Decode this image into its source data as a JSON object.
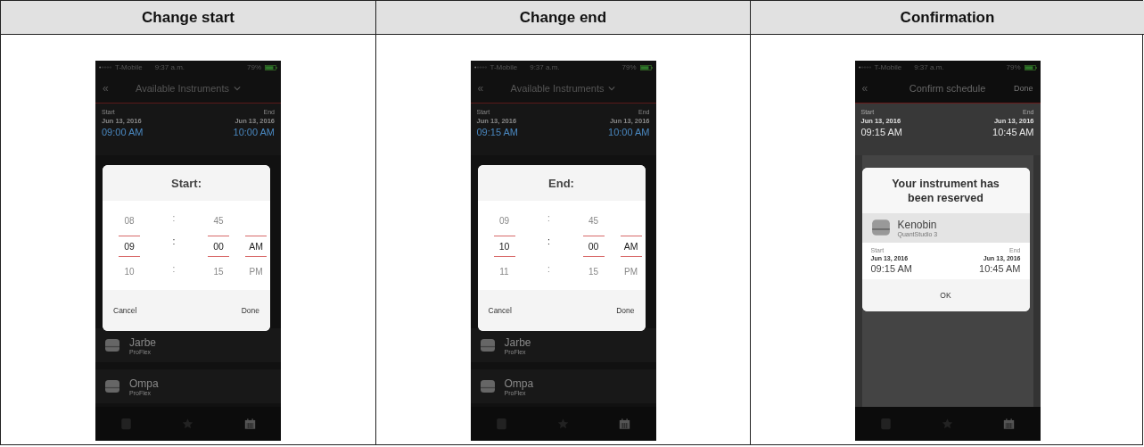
{
  "columns": [
    {
      "heading": "Change start"
    },
    {
      "heading": "Change end"
    },
    {
      "heading": "Confirmation"
    }
  ],
  "screens": [
    {
      "kind": "picker",
      "status": {
        "carrier": "T-Mobile",
        "time": "9:37 a.m.",
        "battery": "79%"
      },
      "nav": {
        "back": "«",
        "title": "Available Instruments",
        "dropdown": true
      },
      "schedule": {
        "start": {
          "label": "Start",
          "date": "Jun 13, 2016",
          "time": "09:00 AM"
        },
        "end": {
          "label": "End",
          "date": "Jun 13, 2016",
          "time": "10:00 AM"
        }
      },
      "instruments": [
        {
          "name": "Jarbe",
          "model": "ProFlex"
        },
        {
          "name": "Ompa",
          "model": "ProFlex"
        }
      ],
      "dialog": {
        "title": "Start:",
        "rows": [
          {
            "hour": "08",
            "separator": ":",
            "minute": "45",
            "selected": false
          },
          {
            "hour": "09",
            "separator": ":",
            "minute": "00",
            "period": "AM",
            "selected": true
          },
          {
            "hour": "10",
            "separator": ":",
            "minute": "15",
            "period": "PM",
            "selected": false
          }
        ],
        "buttons": [
          "Cancel",
          "Done"
        ]
      },
      "tabs": [
        {
          "kind": "instrument",
          "selected": false
        },
        {
          "kind": "star",
          "selected": false
        },
        {
          "kind": "calendar",
          "selected": true
        }
      ]
    },
    {
      "kind": "picker",
      "status": {
        "carrier": "T-Mobile",
        "time": "9:37 a.m.",
        "battery": "79%"
      },
      "nav": {
        "back": "«",
        "title": "Available Instruments",
        "dropdown": true
      },
      "schedule": {
        "start": {
          "label": "Start",
          "date": "Jun 13, 2016",
          "time": "09:15 AM"
        },
        "end": {
          "label": "End",
          "date": "Jun 13, 2016",
          "time": "10:00 AM"
        }
      },
      "instruments": [
        {
          "name": "Jarbe",
          "model": "ProFlex"
        },
        {
          "name": "Ompa",
          "model": "ProFlex"
        }
      ],
      "dialog": {
        "title": "End:",
        "rows": [
          {
            "hour": "09",
            "separator": ":",
            "minute": "45",
            "selected": false
          },
          {
            "hour": "10",
            "separator": ":",
            "minute": "00",
            "period": "AM",
            "selected": true
          },
          {
            "hour": "11",
            "separator": ":",
            "minute": "15",
            "period": "PM",
            "selected": false
          }
        ],
        "buttons": [
          "Cancel",
          "Done"
        ]
      },
      "tabs": [
        {
          "kind": "instrument",
          "selected": false
        },
        {
          "kind": "star",
          "selected": false
        },
        {
          "kind": "calendar",
          "selected": true
        }
      ]
    },
    {
      "kind": "confirmation",
      "status": {
        "carrier": "T-Mobile",
        "time": "9:37 a.m.",
        "battery": "79%"
      },
      "nav": {
        "back": "«",
        "title": "Confirm schedule",
        "action": "Done",
        "dropdown": false
      },
      "schedule": {
        "start": {
          "label": "Start",
          "date": "Jun 13, 2016",
          "time": "09:15 AM"
        },
        "end": {
          "label": "End",
          "date": "Jun 13, 2016",
          "time": "10:45 AM"
        }
      },
      "dialog": {
        "title": "Your instrument has been reserved",
        "instrument": {
          "name": "Kenobin",
          "model": "QuantStudio 3"
        },
        "start": {
          "label": "Start",
          "date": "Jun 13, 2016",
          "time": "09:15 AM"
        },
        "end": {
          "label": "End",
          "date": "Jun 13, 2016",
          "time": "10:45 AM"
        },
        "button": "OK"
      },
      "tabs": [
        {
          "kind": "instrument",
          "selected": false
        },
        {
          "kind": "star",
          "selected": false
        },
        {
          "kind": "calendar",
          "selected": true
        }
      ]
    }
  ]
}
